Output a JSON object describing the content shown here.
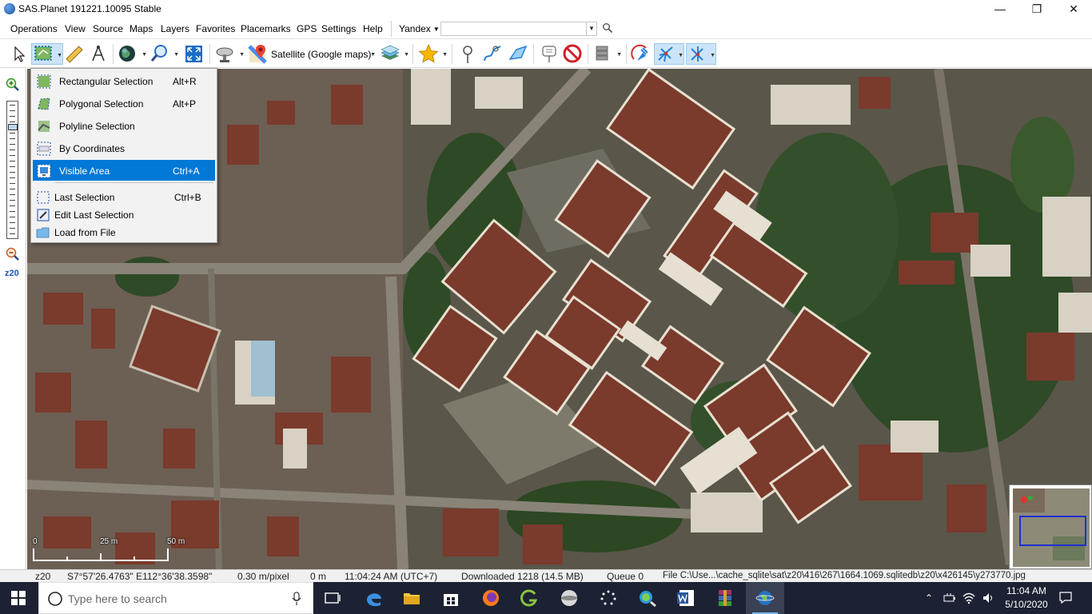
{
  "window": {
    "title": "SAS.Planet 191221.10095 Stable",
    "controls": [
      "minimize-icon",
      "maximize-icon",
      "close-icon"
    ]
  },
  "menubar": {
    "items": [
      "Operations",
      "View",
      "Source",
      "Maps",
      "Layers",
      "Favorites",
      "Placemarks",
      "GPS",
      "Settings",
      "Help"
    ],
    "search_engine": "Yandex",
    "search_value": ""
  },
  "toolbar": {
    "map_name": "Satellite (Google maps)",
    "icons": [
      "pointer-icon",
      "selection-icon",
      "ruler-icon",
      "compass-icon",
      "globe-icon",
      "zoom-tool-icon",
      "fullscreen-icon",
      "satellite-dish-icon",
      "google-maps-icon",
      "layers-icon",
      "favorites-star-icon",
      "placemark-pin-icon",
      "path-icon",
      "polygon-icon",
      "balloon-icon",
      "no-entry-icon",
      "database-icon",
      "gps-icon",
      "gps-track-icon",
      "gps-center-icon"
    ]
  },
  "leftbar": {
    "zoom_label": "z20"
  },
  "dropdown": {
    "items": [
      {
        "label": "Rectangular Selection",
        "shortcut": "Alt+R",
        "icon": "rectangular-selection-icon"
      },
      {
        "label": "Polygonal Selection",
        "shortcut": "Alt+P",
        "icon": "polygonal-selection-icon"
      },
      {
        "label": "Polyline Selection",
        "shortcut": "",
        "icon": "polyline-selection-icon"
      },
      {
        "label": "By Coordinates",
        "shortcut": "",
        "icon": "coordinates-icon"
      },
      {
        "label": "Visible Area",
        "shortcut": "Ctrl+A",
        "icon": "visible-area-icon",
        "highlighted": true
      },
      {
        "label": "Last Selection",
        "shortcut": "Ctrl+B",
        "icon": "last-selection-icon"
      },
      {
        "label": "Edit Last Selection",
        "shortcut": "",
        "icon": "edit-selection-icon"
      },
      {
        "label": "Load from File",
        "shortcut": "",
        "icon": "folder-icon"
      }
    ]
  },
  "scale": {
    "labels": [
      "0",
      "25 m",
      "50 m"
    ]
  },
  "statusbar": {
    "zoom": "z20",
    "coords": "S7°57'26.4763\" E112°36'38.3598\"",
    "resolution": "0.30 m/pixel",
    "distance": "0 m",
    "time": "11:04:24 AM (UTC+7)",
    "downloaded": "Downloaded 1218 (14.5 MB)",
    "queue": "Queue 0",
    "file": "File C:\\Use...\\cache_sqlite\\sat\\z20\\416\\267\\1664.1069.sqlitedb\\z20\\x426145\\y273770.jpg"
  },
  "taskbar": {
    "search_placeholder": "Type here to search",
    "apps": [
      "task-view-icon",
      "edge-icon",
      "file-explorer-icon",
      "store-icon",
      "firefox-icon",
      "app-green-icon",
      "app-disk-icon",
      "app-dots-icon",
      "app-search-globe-icon",
      "word-icon",
      "winrar-icon",
      "sasplanet-icon"
    ],
    "clock_time": "11:04 AM",
    "clock_date": "5/10/2020"
  },
  "colors": {
    "highlight": "#0078d7",
    "taskbar": "#1c2233",
    "roof": "#7a3a2c"
  }
}
